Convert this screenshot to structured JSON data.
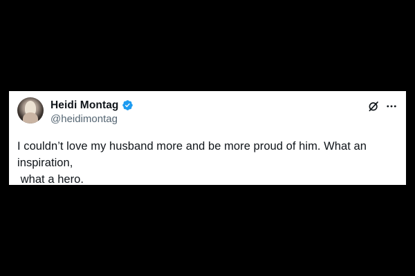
{
  "tweet": {
    "author": {
      "display_name": "Heidi Montag",
      "handle": "@heidimontag",
      "verified": true
    },
    "text": "I couldn’t love my husband more and be more proud of him. What an inspiration,\n what a hero.",
    "icons": {
      "avatar": "profile-photo",
      "verified": "verified-badge-icon",
      "grok": "grok-icon",
      "more": "more-options-icon"
    }
  },
  "colors": {
    "background": "#000000",
    "card": "#ffffff",
    "text_primary": "#0f1419",
    "text_secondary": "#536471",
    "verified_blue": "#1d9bf0"
  }
}
